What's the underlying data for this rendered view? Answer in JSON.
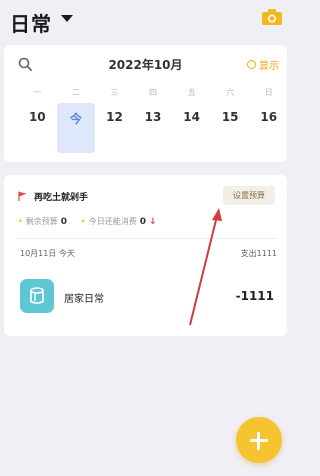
{
  "header": {
    "book_title": "日常",
    "caret_icon": "caret-down-icon",
    "camera_icon": "camera-icon"
  },
  "calendar": {
    "month": "2022年10月",
    "show_toggle": "显示",
    "weekdays": [
      "一",
      "二",
      "三",
      "四",
      "五",
      "六",
      "日"
    ],
    "days": [
      "10",
      "今",
      "12",
      "13",
      "14",
      "15",
      "16"
    ],
    "selected_index": 1,
    "accent": "#5b84e0"
  },
  "budget": {
    "title": "再吃土就剁手",
    "set_button": "设置预算",
    "remaining_label": "剩余预算",
    "remaining_value": "0",
    "today_label": "今日还能消费",
    "today_value": "0"
  },
  "day_summary": {
    "date": "10月11日 今天",
    "spend": "支出1111"
  },
  "entries": [
    {
      "name": "居家日常",
      "amount": "-1111",
      "icon": "home-cup-icon",
      "color": "#5fc6d3"
    }
  ],
  "fab": {
    "icon": "plus-icon",
    "color": "#f7c431"
  }
}
